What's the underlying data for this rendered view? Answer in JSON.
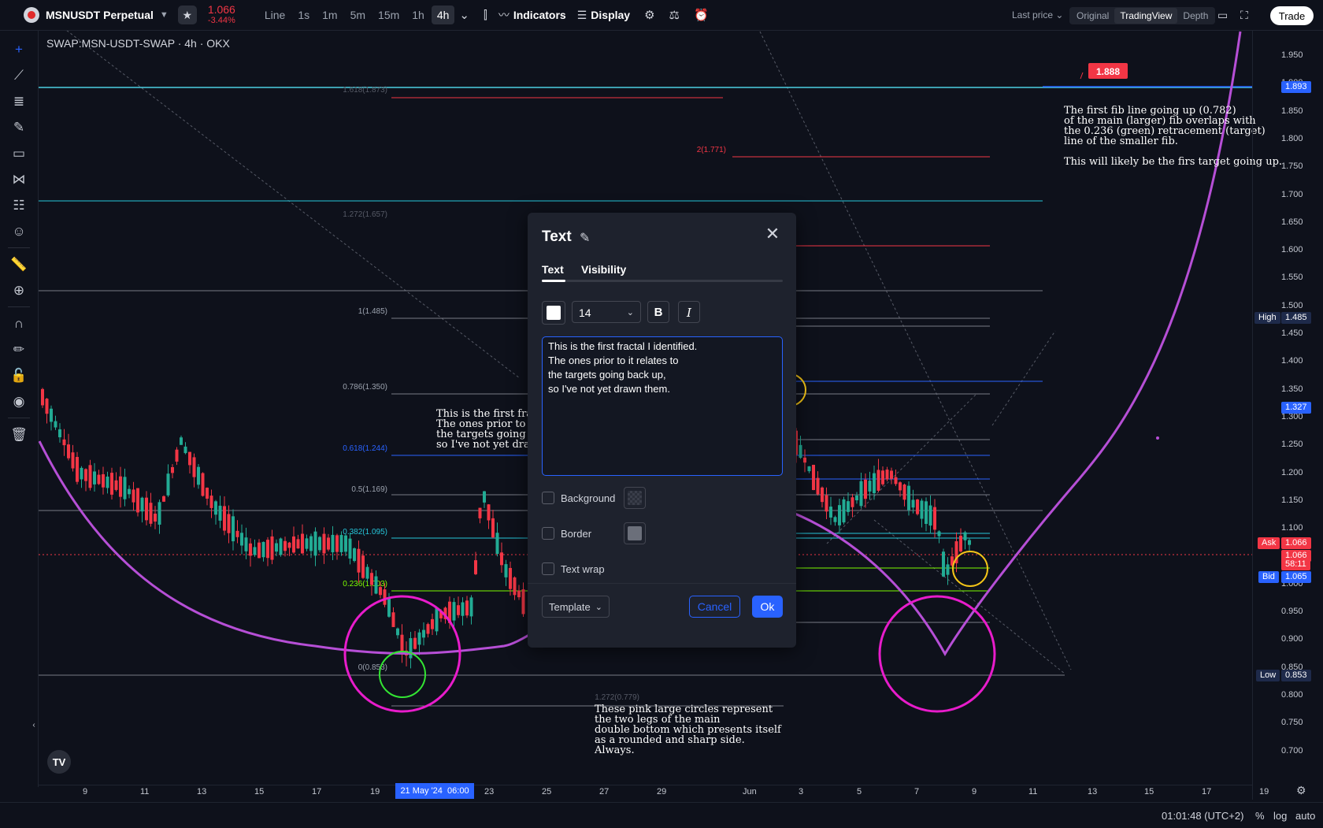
{
  "header": {
    "symbol": "MSNUSDT Perpetual",
    "price": "1.066",
    "change": "-3.44%",
    "timeframes": [
      "Line",
      "1s",
      "1m",
      "5m",
      "15m",
      "1h",
      "4h"
    ],
    "active_timeframe": "4h",
    "indicators_label": "Indicators",
    "display_label": "Display",
    "last_price_label": "Last price",
    "views": [
      "Original",
      "TradingView",
      "Depth"
    ],
    "active_view": "TradingView",
    "trade_label": "Trade"
  },
  "chart": {
    "title": "SWAP:MSN-USDT-SWAP · 4h · OKX",
    "fib_labels": {
      "f1618": "1.618(1.873)",
      "f2": "2(1.771)",
      "f1272": "1.272(1.657)",
      "f1": "1(1.485)",
      "f0786": "0.786(1.350)",
      "f0618": "0.618(1.244)",
      "f05": "0.5(1.169)",
      "f0382": "0.382(1.095)",
      "f0236": "0.236(1.003)",
      "f0": "0(0.853)",
      "f1272b": "1.272(0.779)"
    },
    "callout_price": "1.888",
    "annotation_top_right": "The first fib line going up (0.782)\nof the main (larger) fib overlaps with\nthe 0.236 (green) retracement (target)\nline of the smaller fib.\n\nThis will likely be the firs target going up.",
    "annotation_mid": "This is the first fract\nThe ones prior to it r\nthe targets going bac\nso I've not yet drawn",
    "annotation_bottom": "These pink large circles represent\nthe two legs of the main\ndouble bottom which presents itself\nas a rounded and sharp side.\nAlways."
  },
  "price_axis": {
    "labels": [
      "1.950",
      "1.900",
      "1.850",
      "1.800",
      "1.750",
      "1.700",
      "1.650",
      "1.600",
      "1.550",
      "1.500",
      "1.450",
      "1.400",
      "1.350",
      "1.300",
      "1.250",
      "1.200",
      "1.150",
      "1.100",
      "1.050",
      "1.000",
      "0.950",
      "0.900",
      "0.850",
      "0.800",
      "0.750",
      "0.700"
    ],
    "tag_1893": "1.893",
    "high_label": "High",
    "high_value": "1.485",
    "tag_1327": "1.327",
    "ask_label": "Ask",
    "ask_value": "1.066",
    "last_value": "1.066",
    "countdown": "58:11",
    "bid_label": "Bid",
    "bid_value": "1.065",
    "low_label": "Low",
    "low_value": "0.853"
  },
  "time_axis": {
    "labels": [
      "9",
      "11",
      "13",
      "15",
      "17",
      "19",
      "23",
      "25",
      "27",
      "29",
      "Jun",
      "3",
      "5",
      "7",
      "9",
      "11",
      "13",
      "15",
      "17",
      "19"
    ],
    "cursor_date": "21 May '24",
    "cursor_time": "06:00"
  },
  "status": {
    "clock": "01:01:48 (UTC+2)",
    "percent": "%",
    "log": "log",
    "auto": "auto"
  },
  "dialog": {
    "title": "Text",
    "tabs": [
      "Text",
      "Visibility"
    ],
    "font_size": "14",
    "bold": "B",
    "italic": "I",
    "text_value": "This is the first fractal I identified.\nThe ones prior to it relates to\nthe targets going back up,\nso I've not yet drawn them.",
    "background_label": "Background",
    "border_label": "Border",
    "text_wrap_label": "Text wrap",
    "template_label": "Template",
    "cancel_label": "Cancel",
    "ok_label": "Ok"
  },
  "colors": {
    "accent": "#2962ff",
    "down": "#f23645",
    "up": "#22ab94",
    "magenta": "#b64fd6",
    "pink": "#e81ccb"
  },
  "tradingview_logo": "TV"
}
